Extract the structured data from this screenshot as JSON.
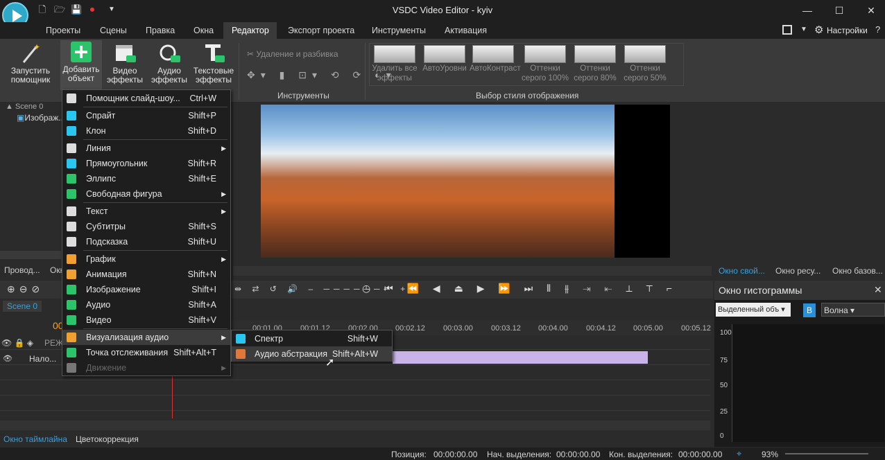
{
  "app": {
    "title": "VSDC Video Editor - kyiv"
  },
  "window_controls": {
    "minimize": "—",
    "maximize": "☐",
    "close": "✕"
  },
  "menu": {
    "tabs": [
      "Проекты",
      "Сцены",
      "Правка",
      "Окна",
      "Редактор",
      "Экспорт проекта",
      "Инструменты",
      "Активация"
    ],
    "active": "Редактор",
    "settings": "Настройки"
  },
  "ribbon": {
    "wizard": "Запустить\nпомощник",
    "add_object": "Добавить\nобъект",
    "video_effects": "Видео\nэффекты",
    "audio_effects": "Аудио\nэффекты",
    "text_effects": "Текстовые\nэффекты",
    "cut_split": "Удаление и разбивка",
    "tools_label": "Инструменты",
    "style_label": "Выбор стиля отображения",
    "styles": [
      "Удалить все эффекты",
      "АвтоУровни",
      "АвтоКонтраст",
      "Оттенки серого 100%",
      "Оттенки серого 80%",
      "Оттенки серого 50%"
    ]
  },
  "left_tree": {
    "scene": "Scene 0",
    "image": "Изображ..."
  },
  "add_menu": {
    "items": [
      {
        "label": "Помощник слайд-шоу...",
        "shortcut": "Ctrl+W",
        "icon": "wand-icon"
      },
      {
        "sep": true
      },
      {
        "label": "Спрайт",
        "shortcut": "Shift+P",
        "icon": "sprite-icon"
      },
      {
        "label": "Клон",
        "shortcut": "Shift+D",
        "icon": "clone-icon"
      },
      {
        "sep": true
      },
      {
        "label": "Линия",
        "shortcut": "",
        "submenu": true,
        "icon": "line-icon"
      },
      {
        "label": "Прямоугольник",
        "shortcut": "Shift+R",
        "icon": "rectangle-icon"
      },
      {
        "label": "Эллипс",
        "shortcut": "Shift+E",
        "icon": "ellipse-icon"
      },
      {
        "label": "Свободная фигура",
        "shortcut": "",
        "submenu": true,
        "icon": "freeform-icon"
      },
      {
        "sep": true
      },
      {
        "label": "Текст",
        "shortcut": "",
        "submenu": true,
        "icon": "text-icon"
      },
      {
        "label": "Субтитры",
        "shortcut": "Shift+S",
        "icon": "subtitles-icon"
      },
      {
        "label": "Подсказка",
        "shortcut": "Shift+U",
        "icon": "tooltip-icon"
      },
      {
        "sep": true
      },
      {
        "label": "График",
        "shortcut": "",
        "submenu": true,
        "icon": "chart-icon"
      },
      {
        "label": "Анимация",
        "shortcut": "Shift+N",
        "icon": "animation-icon"
      },
      {
        "label": "Изображение",
        "shortcut": "Shift+I",
        "icon": "image-icon"
      },
      {
        "label": "Аудио",
        "shortcut": "Shift+A",
        "icon": "audio-icon"
      },
      {
        "label": "Видео",
        "shortcut": "Shift+V",
        "icon": "video-icon"
      },
      {
        "sep": true
      },
      {
        "label": "Визуализация аудио",
        "shortcut": "",
        "submenu": true,
        "icon": "audio-visualization-icon",
        "highlight": true
      },
      {
        "label": "Точка отслеживания",
        "shortcut": "Shift+Alt+T",
        "icon": "tracking-point-icon"
      },
      {
        "label": "Движение",
        "shortcut": "",
        "submenu": true,
        "icon": "motion-icon",
        "disabled": true
      }
    ]
  },
  "sub_menu": {
    "items": [
      {
        "label": "Спектр",
        "shortcut": "Shift+W",
        "icon": "spectrum-icon"
      },
      {
        "label": "Аудио абстракция",
        "shortcut": "Shift+Alt+W",
        "icon": "audio-abstraction-icon",
        "highlight": true
      }
    ]
  },
  "panels": {
    "left_tabs": [
      "Провод...",
      "Окн"
    ],
    "right_tabs": [
      "Окно свой...",
      "Окно ресу...",
      "Окно базов..."
    ]
  },
  "timeline": {
    "scene_tab": "Scene 0",
    "time": "00",
    "ticks": [
      "00:01.00",
      "00:01.12",
      "00:02.00",
      "00:02.12",
      "00:03.00",
      "00:03.12",
      "00:04.00",
      "00:04.12",
      "00:05.00",
      "00:05.12"
    ],
    "mode_label": "РЕЖ",
    "track_label": "Нало..."
  },
  "bottom_tabs": [
    "Окно таймлайна",
    "Цветокоррекция"
  ],
  "histogram": {
    "title": "Окно гистограммы",
    "selector": "Выделенный объ",
    "mode": "Волна",
    "channel_b": "B",
    "y_labels": [
      "100",
      "75",
      "50",
      "25",
      "0"
    ]
  },
  "status": {
    "position_label": "Позиция:",
    "position": "00:00:00.00",
    "sel_start_label": "Нач. выделения:",
    "sel_start": "00:00:00.00",
    "sel_end_label": "Кон. выделения:",
    "sel_end": "00:00:00.00",
    "zoom": "93%"
  }
}
